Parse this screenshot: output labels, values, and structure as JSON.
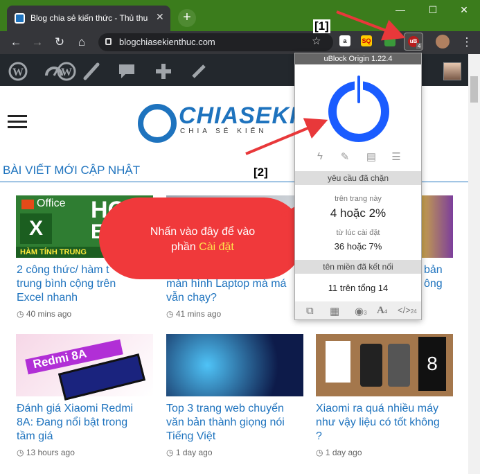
{
  "browser": {
    "tab_title": "Blog chia sẻ kiến thức - Thủ thuật",
    "tab_close": "✕",
    "new_tab": "+",
    "url": "blogchiasekienthuc.com",
    "minimize": "—",
    "maximize": "☐",
    "close": "✕"
  },
  "extensions": {
    "ext1": "a",
    "ext2": "SQ",
    "ublock_icon": "uB",
    "ublock_count": "4"
  },
  "callouts": {
    "label1": "[1]",
    "label2": "[2]",
    "bubble_line1": "Nhấn vào đây để vào",
    "bubble_line2": "phần ",
    "bubble_highlight": "Cài đặt"
  },
  "site": {
    "logo_text": "CHIASEKIEN",
    "logo_sub": "CHIA SẺ KIẾN",
    "section_heading": "BÀI VIẾT MỚI CẬP NHẬT"
  },
  "thumbs": {
    "office_brand": "Office",
    "hoc_text": "HỌC",
    "exc_text": "EXC",
    "ham_text": "HÀM TÍNH TRUNG",
    "redmi_text": "Redmi 8A"
  },
  "posts": [
    {
      "title_l1": "2 công thức/ hàm t",
      "title_l2": "trung bình cộng trên",
      "title_l3": "Excel nhanh",
      "time": "40 mins ago"
    },
    {
      "title_l1": "",
      "title_l2": "màn hình Laptop mà má",
      "title_l3": "vẫn chạy?",
      "time": "41 mins ago"
    },
    {
      "title_l1": "bản",
      "title_l2": "ông",
      "title_l3": "",
      "time": ""
    },
    {
      "title_l1": "Đánh giá Xiaomi Redmi",
      "title_l2": "8A: Đang nổi bật trong",
      "title_l3": "tầm giá",
      "time": "13 hours ago"
    },
    {
      "title_l1": "Top 3 trang web chuyển",
      "title_l2": "văn bản thành giọng nói",
      "title_l3": "Tiếng Việt",
      "time": "1 day ago"
    },
    {
      "title_l1": "Xiaomi ra quá nhiều máy",
      "title_l2": "như vậy liệu có tốt không",
      "title_l3": "?",
      "time": "1 day ago"
    }
  ],
  "popup": {
    "header": "uBlock Origin 1.22.4",
    "blocked_header": "yêu cầu đã chặn",
    "on_page_label": "trên trang này",
    "on_page_value": "4 hoặc 2%",
    "since_install_label": "từ lúc cài đặt",
    "since_install_value": "36 hoặc 7%",
    "domains_header": "tên miền đã kết nối",
    "domains_value": "11 trên tổng 14",
    "foot_sub1": "3",
    "foot_sub2": "4",
    "foot_sub3": "24"
  },
  "colors": {
    "titlebar": "#3b7c1c",
    "accent": "#1e73be",
    "power": "#1a5cff",
    "callout": "#f0393b",
    "arrow": "#e8383a"
  }
}
